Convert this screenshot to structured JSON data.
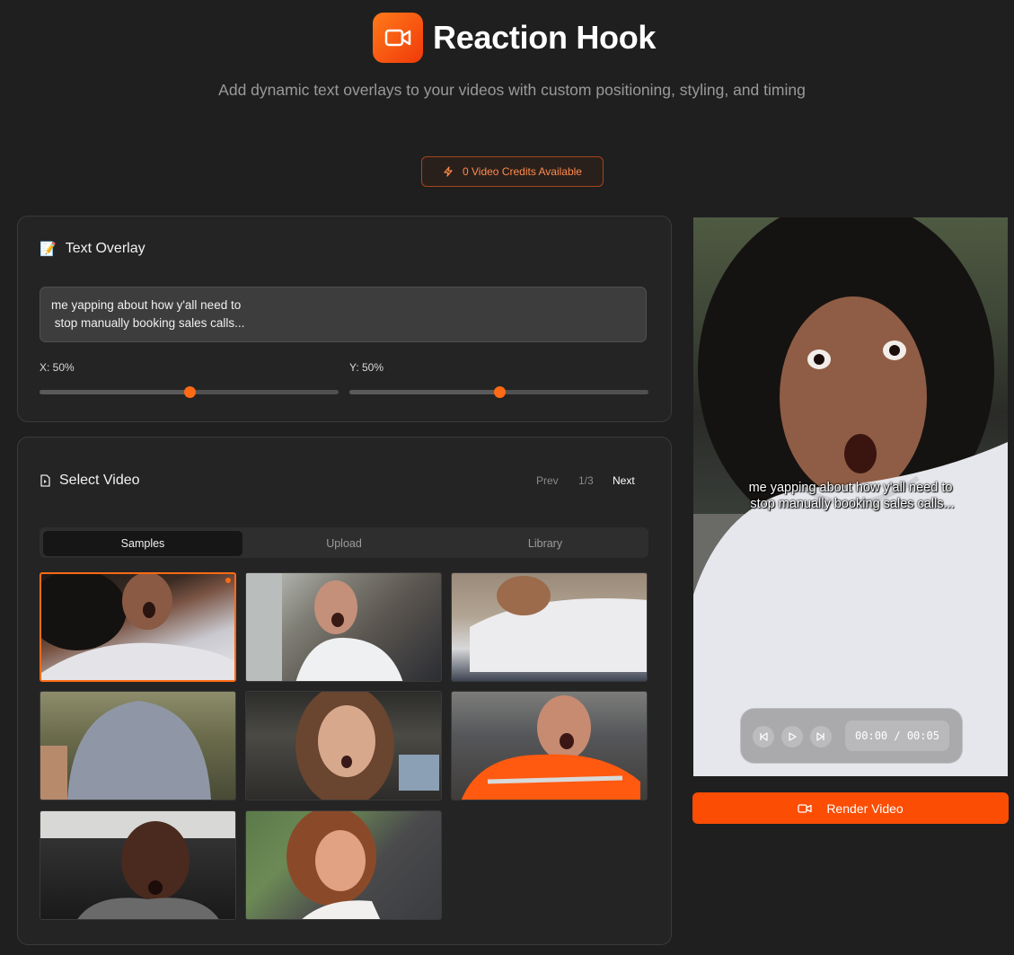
{
  "app": {
    "title": "Reaction Hook",
    "subtitle": "Add dynamic text overlays to your videos with custom positioning, styling, and timing",
    "credits_label": "0 Video Credits Available"
  },
  "text_overlay": {
    "heading": "Text Overlay",
    "heading_emoji": "📝",
    "text": "me yapping about how y'all need to\n stop manually booking sales calls...",
    "x_label": "X: 50%",
    "y_label": "Y: 50%",
    "x_value": 0.5,
    "y_value": 0.5
  },
  "video_select": {
    "heading": "Select Video",
    "prev_label": "Prev",
    "page_indicator": "1/3",
    "next_label": "Next",
    "tabs": [
      "Samples",
      "Upload",
      "Library"
    ],
    "active_tab": "Samples",
    "thumbnails": [
      {
        "name": "woman-curly-hair-surprised",
        "selected": true
      },
      {
        "name": "man-lab-coat-surprised",
        "selected": false
      },
      {
        "name": "white-tshirt-closeup",
        "selected": false
      },
      {
        "name": "man-grey-tshirt-field",
        "selected": false
      },
      {
        "name": "woman-brown-hair-surprised",
        "selected": false
      },
      {
        "name": "man-orange-safety-jacket",
        "selected": false
      },
      {
        "name": "man-car-hoodie-surprised",
        "selected": false
      },
      {
        "name": "woman-street-smiling",
        "selected": false
      }
    ]
  },
  "preview": {
    "overlay_text": "me yapping about how y'all need to\n stop manually booking sales calls...",
    "time_display": "00:00 / 00:05"
  },
  "render_button_label": "Render Video",
  "colors": {
    "accent": "#ff6a14",
    "render_button": "#fb4d04",
    "background": "#1f1f1f",
    "panel": "#242424"
  }
}
